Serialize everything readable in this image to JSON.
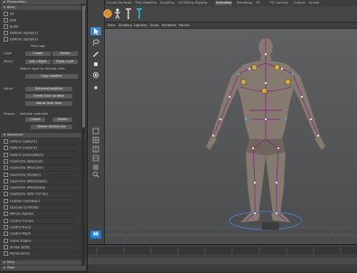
{
  "left_panel": {
    "top_sections": [
      {
        "label": "Preparation"
      },
      {
        "label": "Body"
      }
    ],
    "top_tree": [
      {
        "label": "Fit"
      },
      {
        "label": "Edit"
      },
      {
        "label": "Build"
      },
      {
        "label": "Deform    (option1)"
      },
      {
        "label": "Deform    (option2)"
      }
    ],
    "skincage_header": "SkinCage",
    "skincage": {
      "cage_label": "Cage",
      "create_btn": "Create",
      "delete_btn": "Delete",
      "mirror_label": "Mirror",
      "left_right": "Left->Right",
      "right_left": "Right->Left",
      "search_label": "Search input by skincas rules",
      "copy_weights": "Copy weights",
      "adjust_label": "Adjust",
      "deform_attr": "DeformationAttrib",
      "create_goal": "Create Goal location",
      "adjust_goal": "Adjust Goal area",
      "shapes_label": "Shapes",
      "shapes_btn_label": "Activate controller",
      "shapes_create": "Create",
      "shapes_delete": "Delete",
      "delete_skincurves": "Delete SkinCurves"
    },
    "advanced_header": "Advanced",
    "advanced_items": [
      {
        "label": "Deform    (option1)"
      },
      {
        "label": "Deform    (option2)"
      },
      {
        "label": "Deform    (GlobalMesh)"
      },
      {
        "label": "Geometry (Skeleton)"
      },
      {
        "label": "Geometry (Muscular)"
      },
      {
        "label": "Geometry (Tendon)"
      },
      {
        "label": "Geometry (Macrotopia)"
      },
      {
        "label": "Geometry (Mesotopia)"
      },
      {
        "label": "Geometry (Skin Cut Ha)"
      },
      {
        "label": "Custom Controllers"
      },
      {
        "label": "Upscale Controller"
      },
      {
        "label": "Mirrors System"
      },
      {
        "label": "Control Curves"
      },
      {
        "label": "Control Fixed"
      },
      {
        "label": "Control Mesh"
      },
      {
        "label": "Game Engine"
      },
      {
        "label": "Shape Settle"
      },
      {
        "label": "Partial Joints"
      }
    ],
    "bottom_sections": [
      {
        "label": "Face"
      },
      {
        "label": "Pose"
      }
    ]
  },
  "shelf_tabs": [
    {
      "label": "Curves"
    },
    {
      "label": "Surfaces"
    },
    {
      "label": "Poly Modeling"
    },
    {
      "label": "Sculpting"
    },
    {
      "label": "UV Editing"
    },
    {
      "label": "Rigging"
    },
    {
      "label": "Animation"
    },
    {
      "label": "Rendering"
    },
    {
      "label": "FX"
    },
    {
      "label": "FX Caching"
    },
    {
      "label": "Custom"
    },
    {
      "label": "Arnold"
    }
  ],
  "shelf_icons": [
    {
      "name": "orange-sphere-icon"
    },
    {
      "name": "human-figure-icon"
    },
    {
      "name": "joint-tool-icon"
    },
    {
      "name": "ik-handle-icon"
    }
  ],
  "viewport_menu": [
    {
      "label": "View"
    },
    {
      "label": "Shading"
    },
    {
      "label": "Lighting"
    },
    {
      "label": "Show"
    },
    {
      "label": "Renderer"
    },
    {
      "label": "Panels"
    }
  ],
  "tools": [
    {
      "name": "select-tool-icon"
    },
    {
      "name": "lasso-tool-icon"
    },
    {
      "name": "paint-tool-icon"
    },
    {
      "name": "move-tool-icon"
    },
    {
      "name": "rotate-tool-icon"
    },
    {
      "name": "scale-tool-icon"
    },
    {
      "name": "layout-single-icon"
    },
    {
      "name": "layout-four-icon"
    },
    {
      "name": "layout-side-icon"
    },
    {
      "name": "layout-top-icon"
    },
    {
      "name": "outliner-icon"
    },
    {
      "name": "search-icon"
    },
    {
      "name": "maya-logo-icon"
    }
  ],
  "colors": {
    "accent_blue": "#3d84d6",
    "joint_purple": "#8a2a8a",
    "controller_yellow": "#d7b040",
    "ground_circle": "#4c7fd0"
  }
}
